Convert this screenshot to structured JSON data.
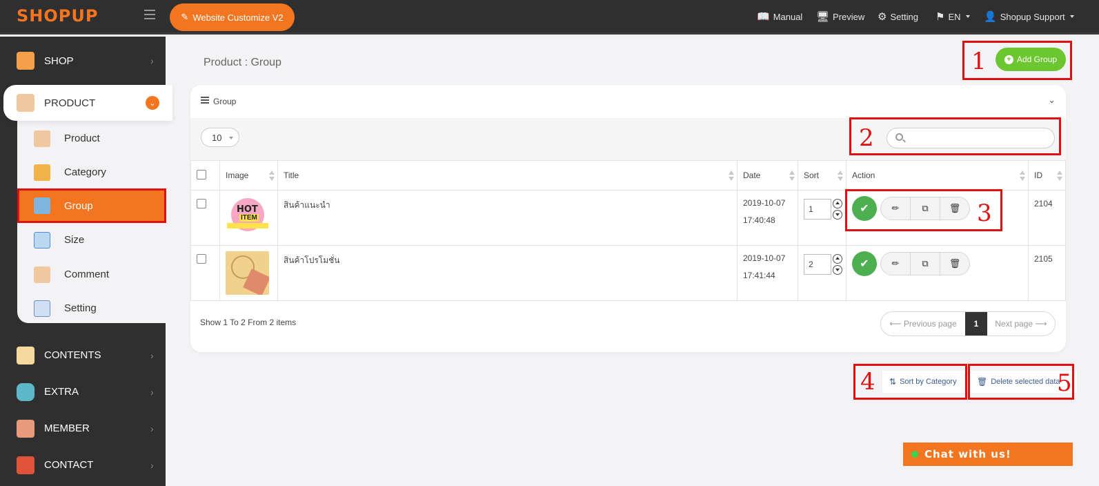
{
  "brand": {
    "logo": "SHOPUP",
    "accent": "#f4751f"
  },
  "topbar": {
    "customize_label": "Website Customize V2",
    "manual_label": "Manual",
    "preview_label": "Preview",
    "setting_label": "Setting",
    "lang_label": "EN",
    "user_label": "Shopup Support"
  },
  "sidebar": {
    "shop": "SHOP",
    "product": "PRODUCT",
    "sub_items": [
      "Product",
      "Category",
      "Group",
      "Size",
      "Comment",
      "Setting"
    ],
    "contents": "CONTENTS",
    "extra": "EXTRA",
    "member": "MEMBER",
    "contact": "CONTACT"
  },
  "page": {
    "title": "Product : Group",
    "add_button": "Add Group"
  },
  "card": {
    "title": "Group",
    "page_size": "10",
    "columns": [
      "Image",
      "Title",
      "Date",
      "Sort",
      "Action",
      "ID"
    ],
    "rows": [
      {
        "title": "สินค้าแนะนำ",
        "date": "2019-10-07",
        "time": "17:40:48",
        "sort": "1",
        "id": "2104"
      },
      {
        "title": "สินค้าโปรโมชั่น",
        "date": "2019-10-07",
        "time": "17:41:44",
        "sort": "2",
        "id": "2105"
      }
    ],
    "summary": "Show 1 To 2 From 2 items",
    "prev": "⟵ Previous page",
    "current_page": "1",
    "next": "Next page ⟶"
  },
  "thumb_text": {
    "hot": "HOT",
    "item": "ITEM"
  },
  "bottom": {
    "sort_by_category": "Sort by Category",
    "delete_selected": "Delete selected data"
  },
  "annotations": [
    "1",
    "2",
    "3",
    "4",
    "5"
  ],
  "chat": {
    "label": "Chat with us!"
  }
}
